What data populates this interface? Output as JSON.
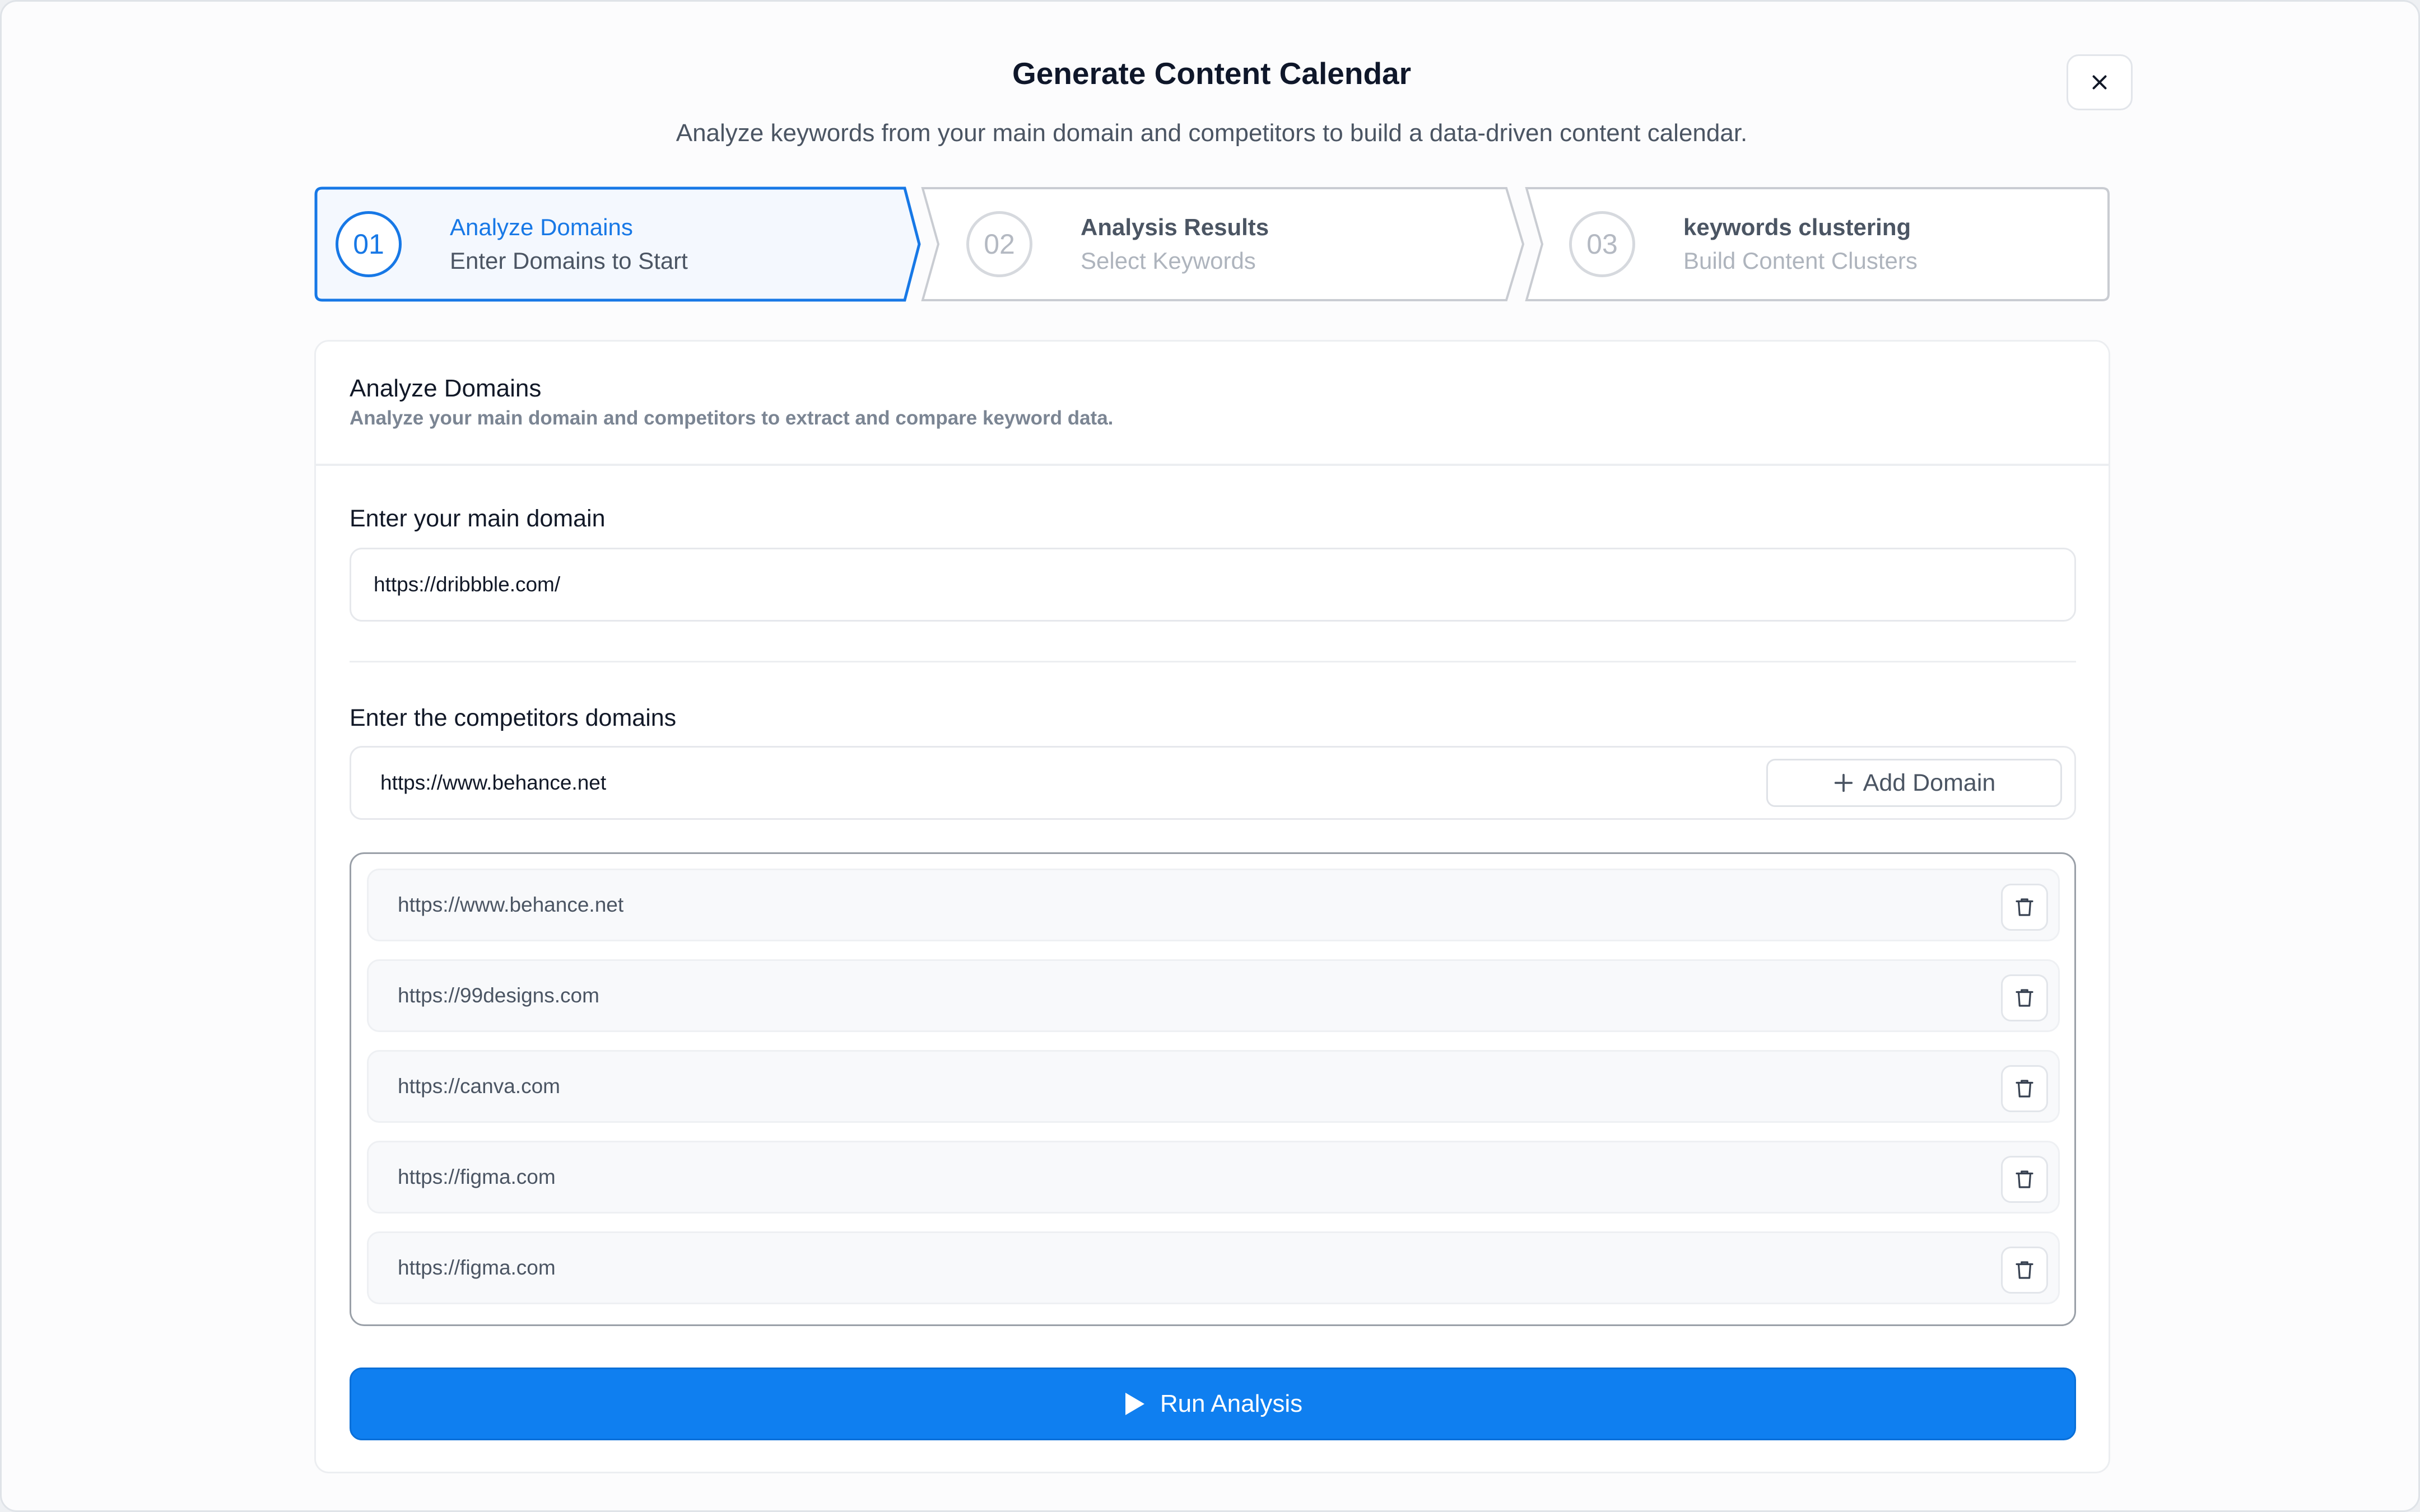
{
  "modal": {
    "title": "Generate Content Calendar",
    "subtitle": "Analyze keywords from your main domain and competitors to build a data-driven content calendar.",
    "close_icon": "close-icon"
  },
  "stepper": {
    "steps": [
      {
        "number": "01",
        "title": "Analyze Domains",
        "subtitle": "Enter Domains to Start",
        "state": "active"
      },
      {
        "number": "02",
        "title": "Analysis Results",
        "subtitle": "Select Keywords",
        "state": "inactive"
      },
      {
        "number": "03",
        "title": "keywords clustering",
        "subtitle": "Build Content Clusters",
        "state": "inactive"
      }
    ]
  },
  "card": {
    "title": "Analyze Domains",
    "description": "Analyze your main domain and competitors to extract and compare keyword data."
  },
  "main_domain": {
    "label": "Enter your main domain",
    "value": "https://dribbble.com/"
  },
  "competitors": {
    "label": "Enter the competitors domains",
    "input_value": "https://www.behance.net",
    "add_label": "Add Domain",
    "list": [
      "https://www.behance.net",
      "https://99designs.com",
      "https://canva.com",
      "https://figma.com",
      "https://figma.com"
    ]
  },
  "run_label": "Run Analysis",
  "colors": {
    "accent": "#0f7ff0",
    "active_step": "#1778e6",
    "border": "#e6e8ec",
    "muted_text": "#4b5563"
  }
}
